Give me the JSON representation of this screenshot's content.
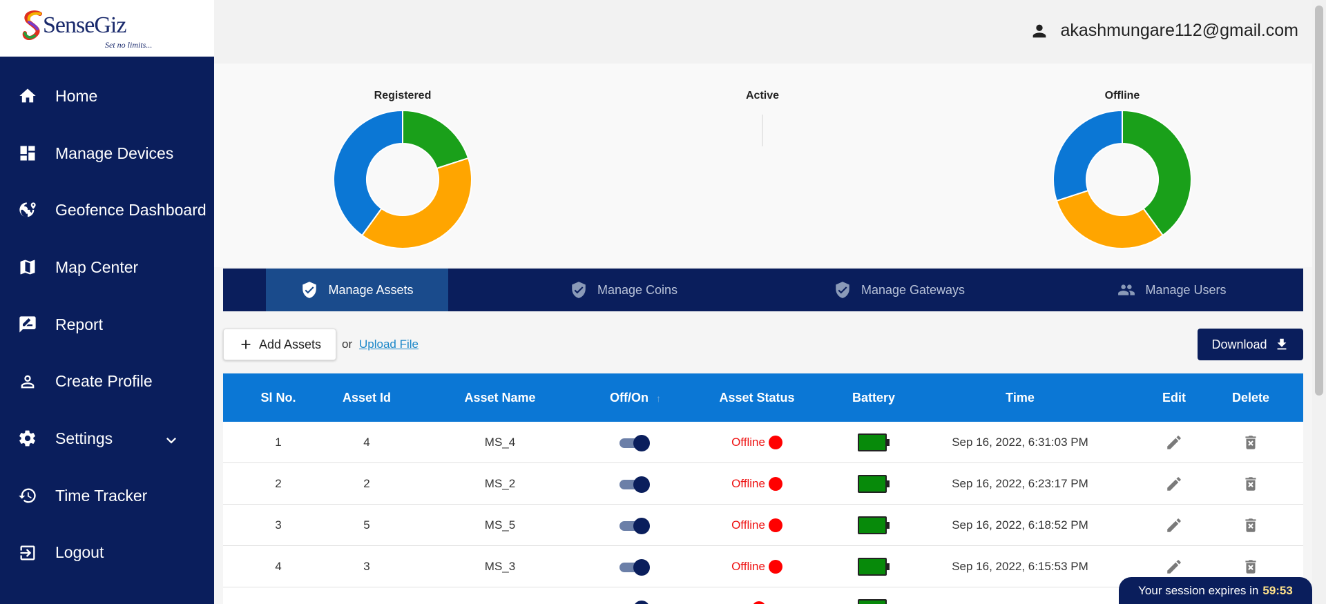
{
  "brand": {
    "name": "SenseGiz",
    "tagline": "Set no limits..."
  },
  "user": {
    "email": "akashmungare112@gmail.com"
  },
  "sidebar": {
    "items": [
      {
        "label": "Home",
        "icon": "home-icon"
      },
      {
        "label": "Manage Devices",
        "icon": "dashboard-icon"
      },
      {
        "label": "Geofence Dashboard",
        "icon": "geofence-icon"
      },
      {
        "label": "Map Center",
        "icon": "map-icon"
      },
      {
        "label": "Report",
        "icon": "report-icon"
      },
      {
        "label": "Create Profile",
        "icon": "person-icon"
      },
      {
        "label": "Settings",
        "icon": "gear-icon"
      },
      {
        "label": "Time Tracker",
        "icon": "history-icon"
      },
      {
        "label": "Logout",
        "icon": "logout-icon"
      }
    ]
  },
  "charts": [
    {
      "title": "Registered",
      "segments": [
        {
          "color": "#1aa01a",
          "value": 20
        },
        {
          "color": "#ffa500",
          "value": 40
        },
        {
          "color": "#0b77d5",
          "value": 40
        }
      ]
    },
    {
      "title": "Active",
      "segments": []
    },
    {
      "title": "Offline",
      "segments": [
        {
          "color": "#1aa01a",
          "value": 40
        },
        {
          "color": "#ffa500",
          "value": 30
        },
        {
          "color": "#0b77d5",
          "value": 30
        }
      ]
    }
  ],
  "tabs": [
    {
      "label": "Manage Assets",
      "active": true
    },
    {
      "label": "Manage Coins",
      "active": false
    },
    {
      "label": "Manage Gateways",
      "active": false
    },
    {
      "label": "Manage Users",
      "active": false
    }
  ],
  "toolbar": {
    "add_label": "Add Assets",
    "or_text": "or",
    "upload_label": "Upload File",
    "download_label": "Download"
  },
  "table": {
    "headers": [
      "Sl No.",
      "Asset Id",
      "Asset Name",
      "Off/On",
      "Asset Status",
      "Battery",
      "Time",
      "Edit",
      "Delete"
    ],
    "rows": [
      {
        "sl": "1",
        "asset_id": "4",
        "asset_name": "MS_4",
        "on": true,
        "status": "Offline",
        "time": "Sep 16, 2022, 6:31:03 PM"
      },
      {
        "sl": "2",
        "asset_id": "2",
        "asset_name": "MS_2",
        "on": true,
        "status": "Offline",
        "time": "Sep 16, 2022, 6:23:17 PM"
      },
      {
        "sl": "3",
        "asset_id": "5",
        "asset_name": "MS_5",
        "on": true,
        "status": "Offline",
        "time": "Sep 16, 2022, 6:18:52 PM"
      },
      {
        "sl": "4",
        "asset_id": "3",
        "asset_name": "MS_3",
        "on": true,
        "status": "Offline",
        "time": "Sep 16, 2022, 6:15:53 PM"
      }
    ]
  },
  "session": {
    "text": "Your session expires in",
    "time": "59:53"
  },
  "colors": {
    "sidebar": "#0a1e5c",
    "accent": "#0b77d5",
    "offline": "#ff0000",
    "battery": "#078a0a"
  }
}
